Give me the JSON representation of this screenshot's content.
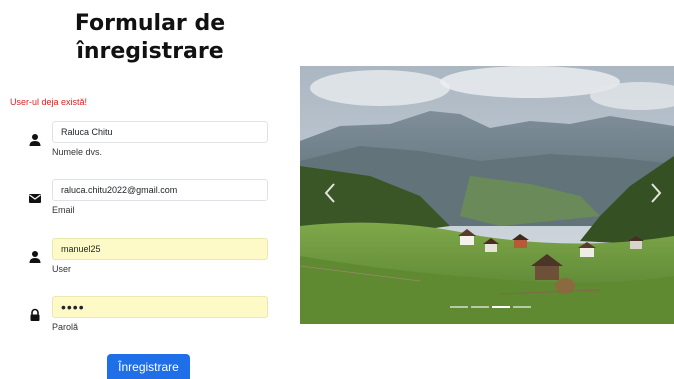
{
  "title": "Formular de înregistrare",
  "error_message": "User-ul deja există!",
  "fields": [
    {
      "name": "name",
      "icon": "user-icon",
      "value": "Raluca Chitu",
      "label": "Numele dvs.",
      "autofill": false,
      "type": "text"
    },
    {
      "name": "email",
      "icon": "envelope-icon",
      "value": "raluca.chitu2022@gmail.com",
      "label": "Email",
      "autofill": false,
      "type": "text"
    },
    {
      "name": "user",
      "icon": "user-icon",
      "value": "manuel25",
      "label": "User",
      "autofill": true,
      "type": "text"
    },
    {
      "name": "password",
      "icon": "lock-icon",
      "value": "••••",
      "label": "Parolă",
      "autofill": true,
      "type": "password"
    }
  ],
  "submit_label": "Înregistrare",
  "carousel": {
    "image": "mountain-village-landscape",
    "indicators": 4,
    "active_indicator": 3
  },
  "colors": {
    "accent": "#1e6fe8",
    "error": "#e02020",
    "autofill": "#fdfac8"
  }
}
